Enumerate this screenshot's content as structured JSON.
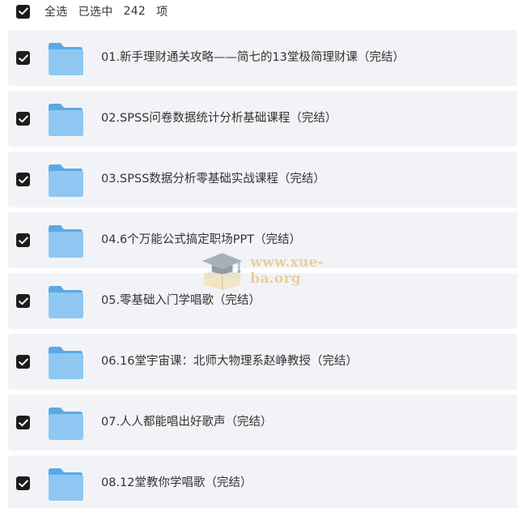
{
  "header": {
    "select_all_label": "全选",
    "selected_label": "已选中",
    "selected_count": "242",
    "unit_label": "项"
  },
  "items": [
    {
      "name": "01.新手理财通关攻略——简七的13堂极简理财课（完结）",
      "checked": true,
      "icon": "folder-icon"
    },
    {
      "name": "02.SPSS问卷数据统计分析基础课程（完结）",
      "checked": true,
      "icon": "folder-icon"
    },
    {
      "name": "03.SPSS数据分析零基础实战课程（完结）",
      "checked": true,
      "icon": "folder-icon"
    },
    {
      "name": "04.6个万能公式搞定职场PPT（完结）",
      "checked": true,
      "icon": "folder-icon"
    },
    {
      "name": "05.零基础入门学唱歌（完结）",
      "checked": true,
      "icon": "folder-icon"
    },
    {
      "name": "06.16堂宇宙课：北师大物理系赵峥教授（完结）",
      "checked": true,
      "icon": "folder-icon"
    },
    {
      "name": "07.人人都能唱出好歌声（完结）",
      "checked": true,
      "icon": "folder-icon"
    },
    {
      "name": "08.12堂教你学唱歌（完结）",
      "checked": true,
      "icon": "folder-icon"
    }
  ],
  "watermark": {
    "text": "www.xue-ba.org"
  },
  "colors": {
    "checkbox": "#1c1c1c",
    "row_background": "#f2f3f6",
    "folder_light": "#8ec8f2",
    "folder_dark": "#5aa9e6",
    "text": "#333333"
  }
}
